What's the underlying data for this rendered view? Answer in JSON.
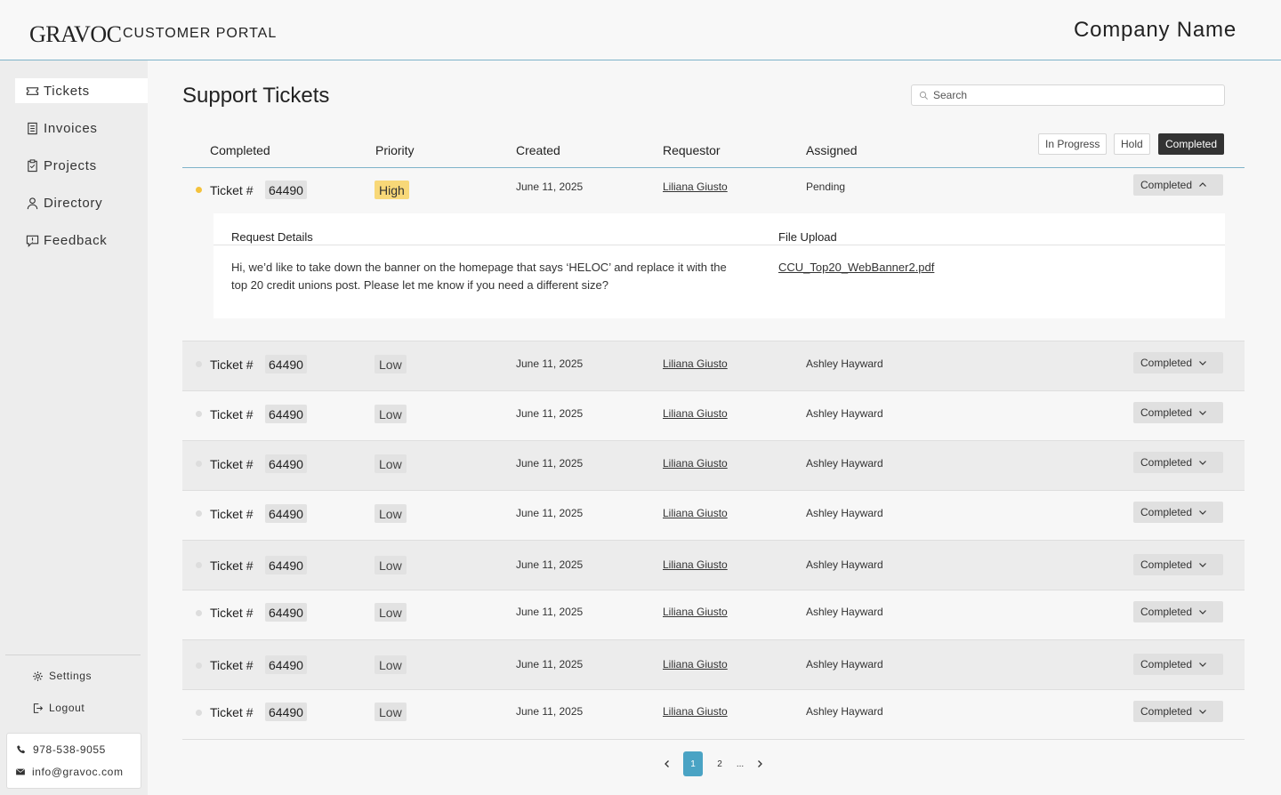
{
  "header": {
    "logo": "GRAVOC",
    "portal_label": "CUSTOMER PORTAL",
    "company": "Company Name"
  },
  "sidebar": {
    "items": [
      {
        "label": "Tickets",
        "icon": "ticket-icon",
        "active": true
      },
      {
        "label": "Invoices",
        "icon": "invoice-icon"
      },
      {
        "label": "Projects",
        "icon": "clipboard-icon"
      },
      {
        "label": "Directory",
        "icon": "person-icon"
      },
      {
        "label": "Feedback",
        "icon": "feedback-icon"
      }
    ],
    "settings": "Settings",
    "logout": "Logout",
    "phone": "978-538-9055",
    "email": "info@gravoc.com"
  },
  "main": {
    "title": "Support Tickets",
    "search_placeholder": "Search",
    "filters": [
      "In Progress",
      "Hold",
      "Completed"
    ],
    "active_filter": "Completed",
    "columns": [
      "Completed",
      "Priority",
      "Created",
      "Requestor",
      "Assigned"
    ],
    "rows": [
      {
        "label": "Ticket #",
        "number": "64490",
        "priority": "High",
        "created": "June 11, 2025",
        "requestor": "Liliana Giusto",
        "assigned": "Pending",
        "status": "Completed",
        "expanded": true
      },
      {
        "label": "Ticket #",
        "number": "64490",
        "priority": "Low",
        "created": "June 11, 2025",
        "requestor": "Liliana Giusto",
        "assigned": "Ashley Hayward",
        "status": "Completed"
      },
      {
        "label": "Ticket #",
        "number": "64490",
        "priority": "Low",
        "created": "June 11, 2025",
        "requestor": "Liliana Giusto",
        "assigned": "Ashley Hayward",
        "status": "Completed"
      },
      {
        "label": "Ticket #",
        "number": "64490",
        "priority": "Low",
        "created": "June 11, 2025",
        "requestor": "Liliana Giusto",
        "assigned": "Ashley Hayward",
        "status": "Completed"
      },
      {
        "label": "Ticket #",
        "number": "64490",
        "priority": "Low",
        "created": "June 11, 2025",
        "requestor": "Liliana Giusto",
        "assigned": "Ashley Hayward",
        "status": "Completed"
      },
      {
        "label": "Ticket #",
        "number": "64490",
        "priority": "Low",
        "created": "June 11, 2025",
        "requestor": "Liliana Giusto",
        "assigned": "Ashley Hayward",
        "status": "Completed"
      },
      {
        "label": "Ticket #",
        "number": "64490",
        "priority": "Low",
        "created": "June 11, 2025",
        "requestor": "Liliana Giusto",
        "assigned": "Ashley Hayward",
        "status": "Completed"
      },
      {
        "label": "Ticket #",
        "number": "64490",
        "priority": "Low",
        "created": "June 11, 2025",
        "requestor": "Liliana Giusto",
        "assigned": "Ashley Hayward",
        "status": "Completed"
      },
      {
        "label": "Ticket #",
        "number": "64490",
        "priority": "Low",
        "created": "June 11, 2025",
        "requestor": "Liliana Giusto",
        "assigned": "Ashley Hayward",
        "status": "Completed"
      }
    ],
    "detail": {
      "heading_details": "Request Details",
      "heading_file": "File Upload",
      "text": "Hi, we’d like to take down the banner on the homepage that says ‘HELOC’ and replace it with the top 20 credit unions post. Please let me know if you need a different size?",
      "file": "CCU_Top20_WebBanner2.pdf"
    },
    "pagination": {
      "pages": [
        "1",
        "2"
      ],
      "current": "1",
      "ellipsis": "..."
    }
  },
  "colors": {
    "accent": "#4aa3c4",
    "high_priority": "#f8d878",
    "active_filter": "#333333",
    "divider": "#7fb3c9"
  }
}
